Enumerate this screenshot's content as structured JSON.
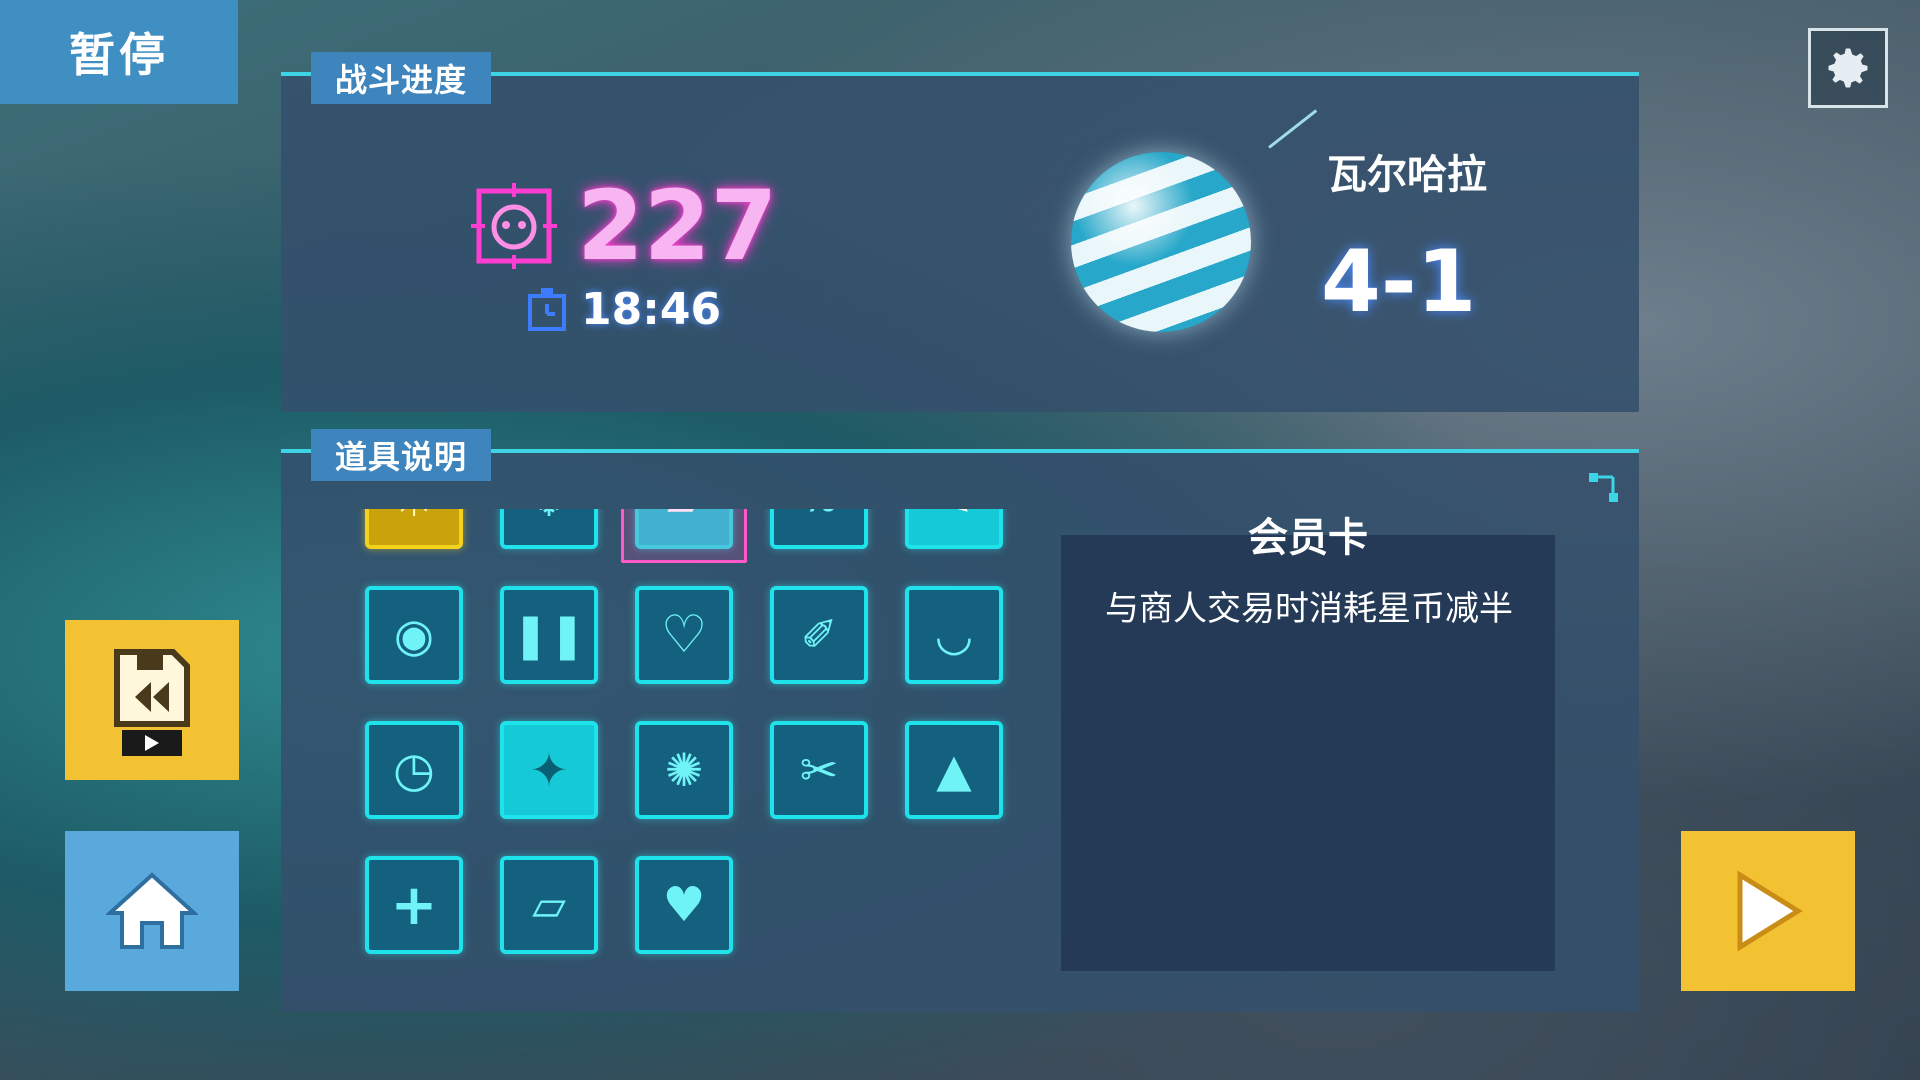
{
  "pause": {
    "label": "暂停"
  },
  "settings": {
    "icon": "gear-icon"
  },
  "battle": {
    "header": "战斗进度",
    "kills": "227",
    "time": "18:46",
    "planet_name": "瓦尔哈拉",
    "level": "4-1"
  },
  "items_panel": {
    "header": "道具说明",
    "items": [
      "gold-sun-icon",
      "snowflake-shield-icon",
      "card-icon",
      "percent-icon",
      "boot-icon",
      "bear-icon",
      "pause-icon",
      "heart-icon",
      "pen-icon",
      "eye-icon",
      "clock-icon",
      "leaf-icon",
      "spark-icon",
      "tools-icon",
      "flame-icon",
      "medkit-icon",
      "tickets-icon",
      "broken-heart-icon"
    ],
    "selected_index": 2,
    "detail": {
      "title": "会员卡",
      "description": "与商人交易时消耗星币减半"
    }
  },
  "buttons": {
    "replay": "replay-save-icon",
    "home": "home-icon",
    "resume": "play-icon"
  },
  "colors": {
    "accent": "#3dd4e6",
    "kills": "#ff3dd2",
    "gold": "#f2c233"
  }
}
